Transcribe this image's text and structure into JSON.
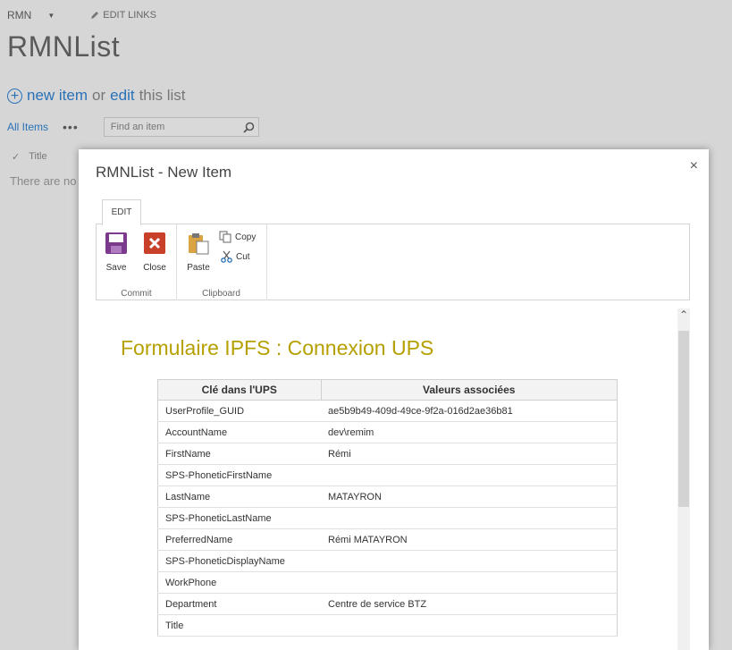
{
  "site": {
    "name": "RMN",
    "edit_links": "EDIT LINKS"
  },
  "page": {
    "title": "RMNList"
  },
  "actions": {
    "new_item": "new item",
    "or": "or",
    "edit": "edit",
    "this_list": "this list"
  },
  "views": {
    "all_items": "All Items",
    "more": "•••",
    "search_placeholder": "Find an item"
  },
  "list": {
    "column_title": "Title",
    "empty_message": "There are no"
  },
  "dialog": {
    "title": "RMNList - New Item",
    "close": "×",
    "ribbon_tab": "EDIT",
    "commit": {
      "label": "Commit",
      "save": "Save",
      "close": "Close"
    },
    "clipboard": {
      "label": "Clipboard",
      "paste": "Paste",
      "copy": "Copy",
      "cut": "Cut"
    }
  },
  "form": {
    "title": "Formulaire IPFS : Connexion UPS",
    "headers": [
      "Clé dans l'UPS",
      "Valeurs associées"
    ],
    "rows": [
      [
        "UserProfile_GUID",
        "ae5b9b49-409d-49ce-9f2a-016d2ae36b81"
      ],
      [
        "AccountName",
        "dev\\remim"
      ],
      [
        "FirstName",
        "Rémi"
      ],
      [
        "SPS-PhoneticFirstName",
        ""
      ],
      [
        "LastName",
        "MATAYRON"
      ],
      [
        "SPS-PhoneticLastName",
        ""
      ],
      [
        "PreferredName",
        "Rémi MATAYRON"
      ],
      [
        "SPS-PhoneticDisplayName",
        ""
      ],
      [
        "WorkPhone",
        ""
      ],
      [
        "Department",
        "Centre de service BTZ"
      ],
      [
        "Title",
        ""
      ]
    ]
  },
  "colors": {
    "accent": "#2a72b8",
    "form_title": "#b5a000",
    "save_icon": "#7c3a8c",
    "close_icon": "#c9402a"
  }
}
